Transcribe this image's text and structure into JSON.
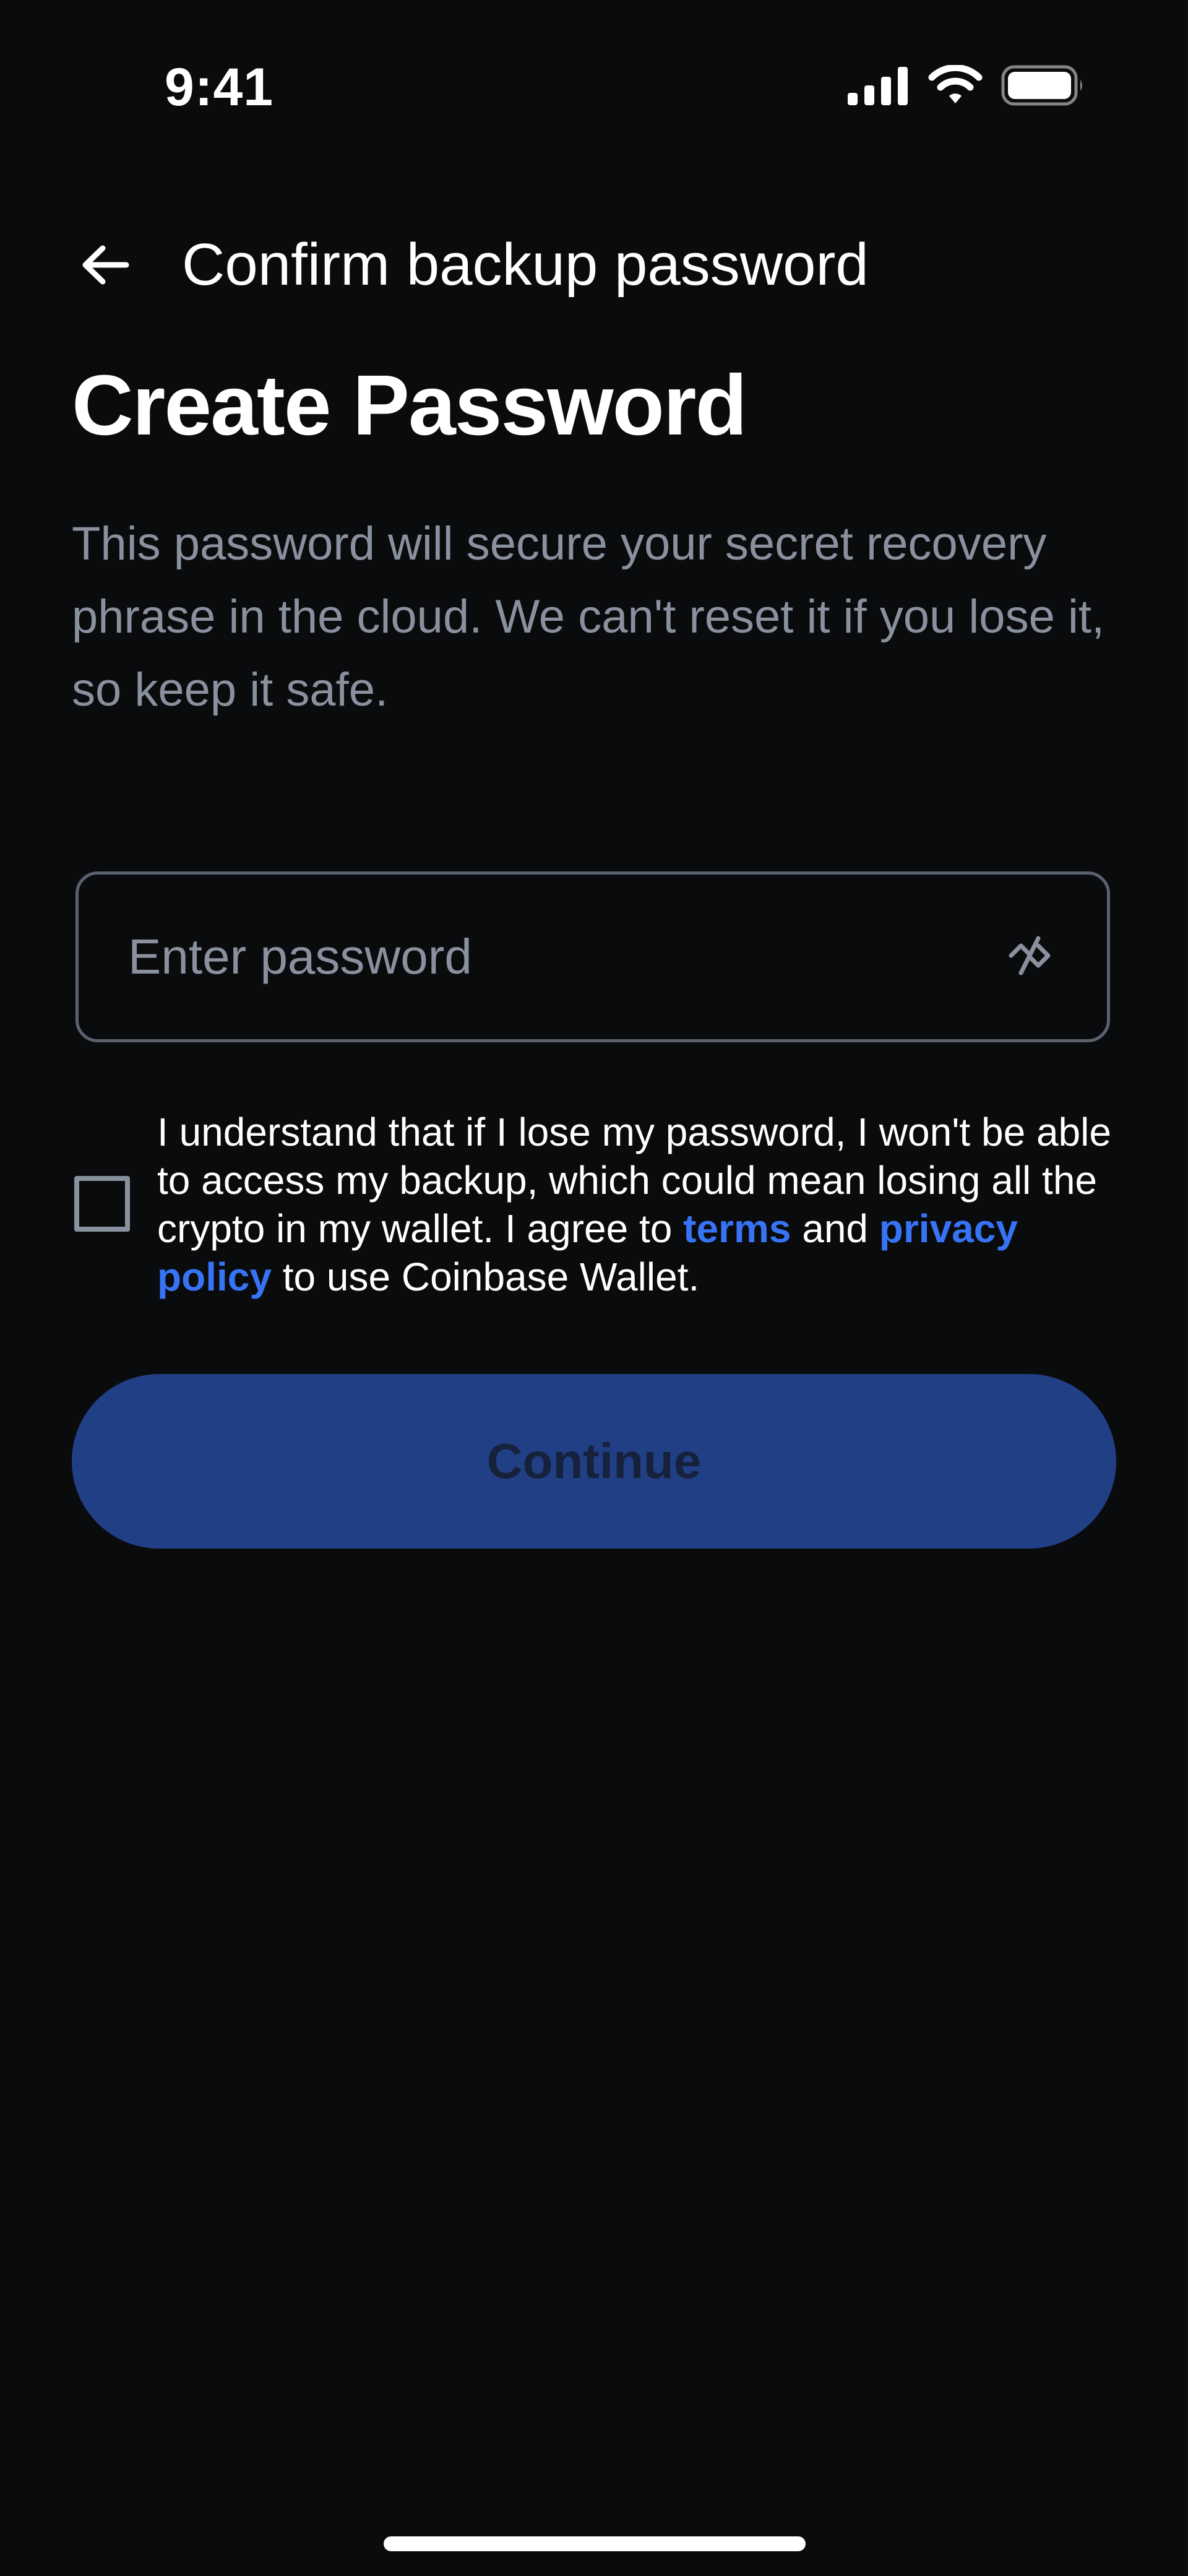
{
  "status_bar": {
    "time": "9:41",
    "signal_icon": "cellular-signal-icon",
    "wifi_icon": "wifi-icon",
    "battery_icon": "battery-icon"
  },
  "nav": {
    "back_icon": "arrow-left-icon",
    "title": "Confirm backup password"
  },
  "page": {
    "title": "Create Password",
    "description": "This password will secure your secret recovery phrase in the cloud. We can't reset it if you lose it, so keep it safe."
  },
  "password": {
    "value": "",
    "placeholder": "Enter password",
    "visibility_icon": "eye-off-icon"
  },
  "agreement": {
    "checked": false,
    "text_before": "I understand that if I lose my password, I won't be able to access my backup, which could mean losing all the crypto in my wallet. I agree to ",
    "terms_label": "terms",
    "text_middle": " and ",
    "privacy_label": "privacy policy",
    "text_after": " to use Coinbase Wallet."
  },
  "actions": {
    "continue_label": "Continue"
  },
  "colors": {
    "background": "#0a0b0d",
    "text_primary": "#ffffff",
    "text_secondary": "#8a919e",
    "link": "#3773f5",
    "button_disabled_bg": "#213f84",
    "button_disabled_text": "#16213b",
    "field_border": "#5b616e"
  }
}
